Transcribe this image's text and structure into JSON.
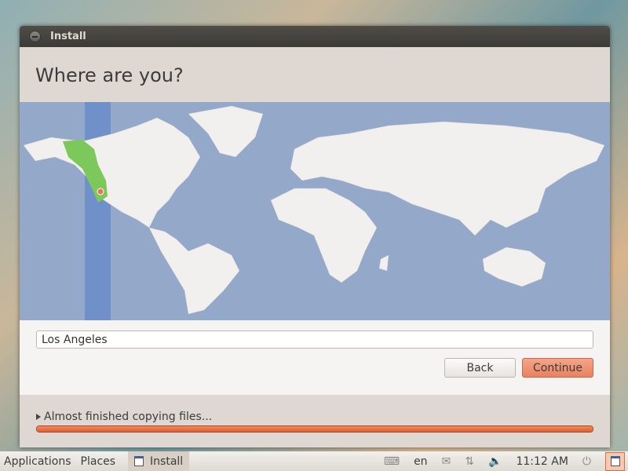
{
  "window": {
    "title": "Install"
  },
  "header": {
    "title": "Where are you?"
  },
  "map": {
    "selected_timezone": "Los Angeles",
    "ocean_color": "#94a8c9",
    "highlight_band_color": "#6f90c8",
    "selected_region_color": "#7cc85a",
    "land_color": "#f2f0ee"
  },
  "form": {
    "city_value": "Los Angeles",
    "back_label": "Back",
    "continue_label": "Continue"
  },
  "progress": {
    "status": "Almost finished copying files...",
    "percent": 100,
    "color": "#e8693b"
  },
  "panel": {
    "applications": "Applications",
    "places": "Places",
    "task": "Install",
    "language": "en",
    "clock": "11:12 AM",
    "icons": [
      "keyboard-icon",
      "mail-icon",
      "network-icon",
      "volume-icon",
      "power-icon",
      "show-desktop-icon"
    ]
  }
}
